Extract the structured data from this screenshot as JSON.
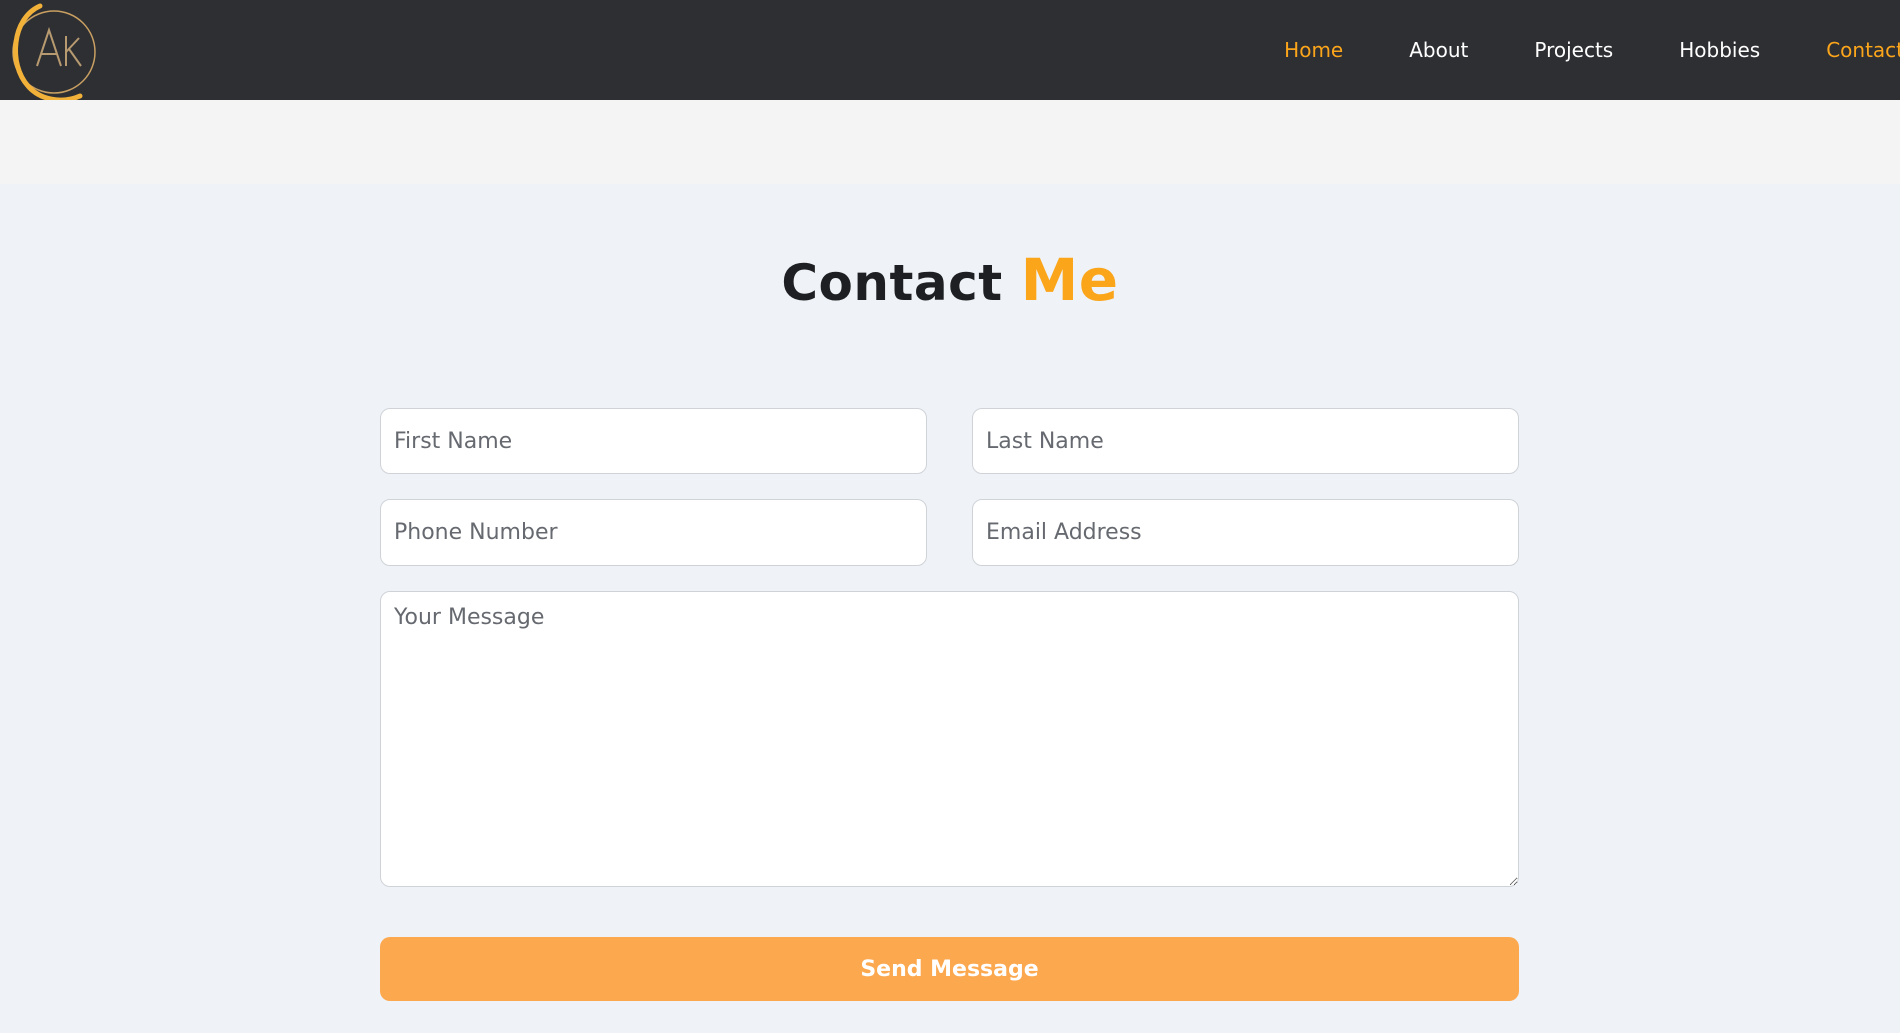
{
  "logo": {
    "letters": "AK",
    "icon": "ak-monogram-logo"
  },
  "nav": {
    "items": [
      {
        "label": "Home"
      },
      {
        "label": "About"
      },
      {
        "label": "Projects"
      },
      {
        "label": "Hobbies"
      },
      {
        "label": "Contact"
      }
    ]
  },
  "contact": {
    "title_main": "Contact",
    "title_accent": "Me",
    "fields": {
      "first_name": {
        "placeholder": "First Name",
        "value": ""
      },
      "last_name": {
        "placeholder": "Last Name",
        "value": ""
      },
      "phone": {
        "placeholder": "Phone Number",
        "value": ""
      },
      "email": {
        "placeholder": "Email Address",
        "value": ""
      },
      "message": {
        "placeholder": "Your Message",
        "value": ""
      }
    },
    "submit_label": "Send Message"
  },
  "colors": {
    "navbar_bg": "#2e2f33",
    "accent": "#fba51b",
    "button_bg": "#fca84e",
    "page_bg": "#eff2f6"
  }
}
